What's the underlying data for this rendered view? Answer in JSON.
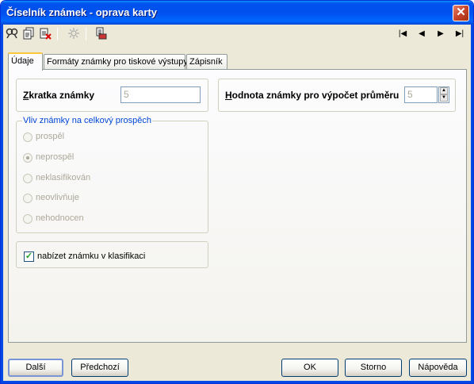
{
  "window": {
    "title": "Číselník známek - oprava karty"
  },
  "toolbar": {
    "icons": [
      "find-icon",
      "copy-record-icon",
      "delete-record-icon",
      "filter-icon",
      "print-icon"
    ],
    "nav": {
      "first": "|◀",
      "prev": "◀",
      "next": "▶",
      "last": "▶|"
    }
  },
  "tabs": [
    {
      "label": "Údaje",
      "active": true
    },
    {
      "label": "Formáty známky pro tiskové výstupy",
      "active": false
    },
    {
      "label": "Zápisník",
      "active": false
    }
  ],
  "form": {
    "zkratka_label_u": "Z",
    "zkratka_label_rest": "kratka známky",
    "zkratka_value": "5",
    "hodnota_label_u": "H",
    "hodnota_label_rest": "odnota známky pro výpočet průměru",
    "hodnota_value": "5",
    "vliv_group_label": "Vliv známky na celkový prospěch",
    "radio_options": [
      "prospěl",
      "neprospěl",
      "neklasifikován",
      "neovlivňuje",
      "nehodnocen"
    ],
    "radio_selected": "neprospěl",
    "checkbox_label": "nabízet známku v klasifikaci",
    "checkbox_checked": true
  },
  "buttons": {
    "next": "Další",
    "prev": "Předchozí",
    "ok": "OK",
    "cancel": "Storno",
    "help": "Nápověda"
  },
  "colors": {
    "titlebar": "#0054e3",
    "group_label": "#0046d5",
    "disabled_text": "#aca899",
    "checkbox_mark": "#21a121"
  }
}
